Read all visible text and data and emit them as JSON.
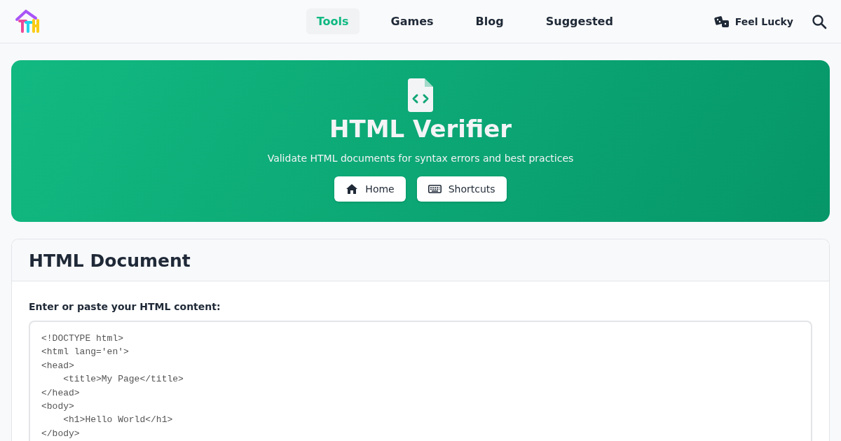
{
  "header": {
    "nav": [
      {
        "label": "Tools",
        "selected": true
      },
      {
        "label": "Games",
        "selected": false
      },
      {
        "label": "Blog",
        "selected": false
      },
      {
        "label": "Suggested",
        "selected": false
      }
    ],
    "lucky": "Feel Lucky"
  },
  "hero": {
    "title": "HTML Verifier",
    "subtitle": "Validate HTML documents for syntax errors and best practices",
    "buttons": [
      {
        "kind": "home",
        "label": "Home"
      },
      {
        "kind": "keyboard",
        "label": "Shortcuts"
      }
    ]
  },
  "card": {
    "title": "HTML Document",
    "field_label": "Enter or paste your HTML content:",
    "value": "<!DOCTYPE html>\n<html lang='en'>\n<head>\n    <title>My Page</title>\n</head>\n<body>\n    <h1>Hello World</h1>\n</body>"
  }
}
